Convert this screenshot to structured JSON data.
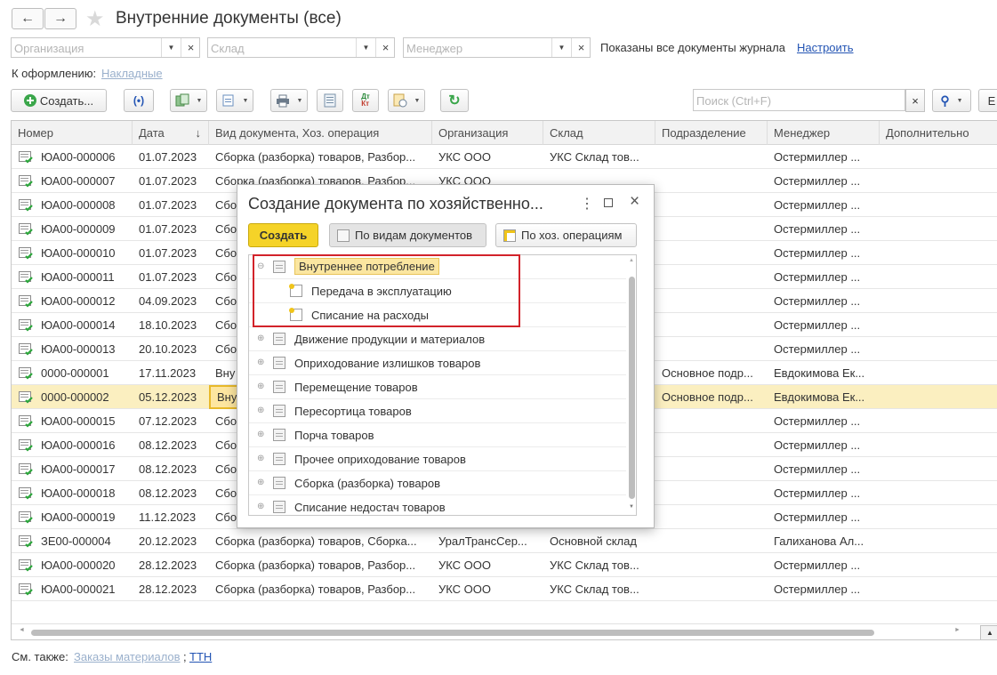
{
  "window": {
    "title": "Внутренние документы (все)",
    "back_glyph": "←",
    "forward_glyph": "→",
    "star_glyph": "★"
  },
  "filters": {
    "organization_placeholder": "Организация",
    "warehouse_placeholder": "Склад",
    "manager_placeholder": "Менеджер",
    "info_text": "Показаны все документы журнала",
    "configure_link": "Настроить"
  },
  "processing": {
    "label": "К оформлению:",
    "link": "Накладные"
  },
  "toolbar": {
    "create_label": "Создать...",
    "search_placeholder": "Поиск (Ctrl+F)"
  },
  "table": {
    "columns": [
      "Номер",
      "Дата",
      "Вид документа, Хоз. операция",
      "Организация",
      "Склад",
      "Подразделение",
      "Менеджер",
      "Дополнительно"
    ],
    "sort_glyph": "↓",
    "selected_index": 10,
    "rows": [
      {
        "num": "ЮА00-000006",
        "date": "01.07.2023",
        "kind": "Сборка (разборка) товаров, Разбор...",
        "org": "УКС ООО",
        "wh": "УКС Склад тов...",
        "dep": "",
        "mgr": "Остермиллер ..."
      },
      {
        "num": "ЮА00-000007",
        "date": "01.07.2023",
        "kind": "Сборка (разборка) товаров, Разбор...",
        "org": "УКС ООО",
        "wh": "",
        "dep": "",
        "mgr": "Остермиллер ..."
      },
      {
        "num": "ЮА00-000008",
        "date": "01.07.2023",
        "kind": "Сбо",
        "org": "",
        "wh": "",
        "dep": "",
        "mgr": "Остермиллер ..."
      },
      {
        "num": "ЮА00-000009",
        "date": "01.07.2023",
        "kind": "Сбо",
        "org": "",
        "wh": "",
        "dep": "",
        "mgr": "Остермиллер ..."
      },
      {
        "num": "ЮА00-000010",
        "date": "01.07.2023",
        "kind": "Сбо",
        "org": "",
        "wh": "",
        "dep": "",
        "mgr": "Остермиллер ..."
      },
      {
        "num": "ЮА00-000011",
        "date": "01.07.2023",
        "kind": "Сбо",
        "org": "",
        "wh": "",
        "dep": "",
        "mgr": "Остермиллер ..."
      },
      {
        "num": "ЮА00-000012",
        "date": "04.09.2023",
        "kind": "Сбо",
        "org": "",
        "wh": "",
        "dep": "",
        "mgr": "Остермиллер ..."
      },
      {
        "num": "ЮА00-000014",
        "date": "18.10.2023",
        "kind": "Сбо",
        "org": "",
        "wh": "",
        "dep": "",
        "mgr": "Остермиллер ..."
      },
      {
        "num": "ЮА00-000013",
        "date": "20.10.2023",
        "kind": "Сбо",
        "org": "",
        "wh": "",
        "dep": "",
        "mgr": "Остермиллер ..."
      },
      {
        "num": "0000-000001",
        "date": "17.11.2023",
        "kind": "Вну",
        "org": "",
        "wh": "",
        "dep": "Основное подр...",
        "mgr": "Евдокимова Ек..."
      },
      {
        "num": "0000-000002",
        "date": "05.12.2023",
        "kind": "Вну",
        "org": "",
        "wh": "",
        "dep": "Основное подр...",
        "mgr": "Евдокимова Ек..."
      },
      {
        "num": "ЮА00-000015",
        "date": "07.12.2023",
        "kind": "Сбо",
        "org": "",
        "wh": "",
        "dep": "",
        "mgr": "Остермиллер ..."
      },
      {
        "num": "ЮА00-000016",
        "date": "08.12.2023",
        "kind": "Сбо",
        "org": "",
        "wh": "",
        "dep": "",
        "mgr": "Остермиллер ..."
      },
      {
        "num": "ЮА00-000017",
        "date": "08.12.2023",
        "kind": "Сбо",
        "org": "",
        "wh": "",
        "dep": "",
        "mgr": "Остермиллер ..."
      },
      {
        "num": "ЮА00-000018",
        "date": "08.12.2023",
        "kind": "Сбо",
        "org": "",
        "wh": "",
        "dep": "",
        "mgr": "Остермиллер ..."
      },
      {
        "num": "ЮА00-000019",
        "date": "11.12.2023",
        "kind": "Сбо",
        "org": "",
        "wh": "",
        "dep": "",
        "mgr": "Остермиллер ..."
      },
      {
        "num": "ЗЕ00-000004",
        "date": "20.12.2023",
        "kind": "Сборка (разборка) товаров, Сборка...",
        "org": "УралТрансСер...",
        "wh": "Основной склад",
        "dep": "",
        "mgr": "Галиханова Ал..."
      },
      {
        "num": "ЮА00-000020",
        "date": "28.12.2023",
        "kind": "Сборка (разборка) товаров, Разбор...",
        "org": "УКС ООО",
        "wh": "УКС Склад тов...",
        "dep": "",
        "mgr": "Остермиллер ..."
      },
      {
        "num": "ЮА00-000021",
        "date": "28.12.2023",
        "kind": "Сборка (разборка) товаров, Разбор...",
        "org": "УКС ООО",
        "wh": "УКС Склад тов...",
        "dep": "",
        "mgr": "Остермиллер ..."
      }
    ]
  },
  "dialog": {
    "title": "Создание документа по хозяйственно...",
    "create_label": "Создать",
    "by_doc_types_label": "По видам документов",
    "by_operations_label": "По хоз. операциям",
    "tree": [
      {
        "label": "Внутреннее потребление",
        "level": 0,
        "expanded": true,
        "highlight": true
      },
      {
        "label": "Передача в эксплуатацию",
        "level": 1
      },
      {
        "label": "Списание на расходы",
        "level": 1
      },
      {
        "label": "Движение продукции и материалов",
        "level": 0
      },
      {
        "label": "Оприходование излишков товаров",
        "level": 0
      },
      {
        "label": "Перемещение товаров",
        "level": 0
      },
      {
        "label": "Пересортица товаров",
        "level": 0
      },
      {
        "label": "Порча товаров",
        "level": 0
      },
      {
        "label": "Прочее оприходование товаров",
        "level": 0
      },
      {
        "label": "Сборка (разборка) товаров",
        "level": 0
      },
      {
        "label": "Списание недостач товаров",
        "level": 0
      }
    ]
  },
  "footer": {
    "see_also_label": "См. также:",
    "link1": "Заказы материалов",
    "separator": ";",
    "link2": "ТТН"
  },
  "colors": {
    "accent_yellow": "#f5d328",
    "selected_row": "#fbefc0",
    "link": "#2455b4",
    "callout_red": "#d2232a"
  }
}
